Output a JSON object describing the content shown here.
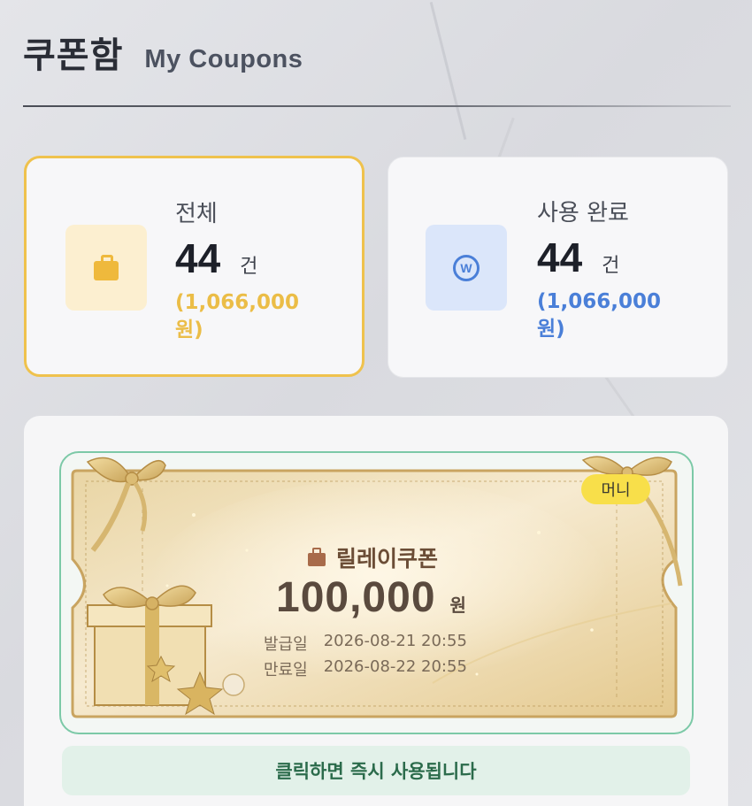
{
  "header": {
    "title": "쿠폰함",
    "subtitle": "My Coupons"
  },
  "stats": {
    "total": {
      "label": "전체",
      "count": "44",
      "unit": "건",
      "amount": "(1,066,000 원)",
      "icon": "bag-icon",
      "accent": "#efc24d"
    },
    "used": {
      "label": "사용 완료",
      "count": "44",
      "unit": "건",
      "amount": "(1,066,000 원)",
      "icon": "won-coin-icon",
      "accent": "#4a7fd8"
    }
  },
  "coupon": {
    "badge": "머니",
    "name": "릴레이쿠폰",
    "amount": "100,000",
    "unit": "원",
    "issued_label": "발급일",
    "issued_date": "2026-08-21 20:55",
    "expiry_label": "만료일",
    "expiry_date": "2026-08-22 20:55",
    "action": "클릭하면 즉시 사용됩니다",
    "icon": "bag-icon"
  }
}
